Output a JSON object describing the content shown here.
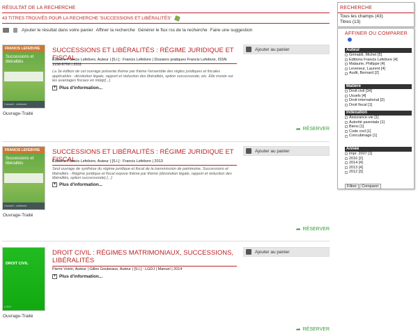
{
  "results": {
    "heading": "RÉSULTAT DE LA RECHERCHE",
    "count_text": "43 TITRES TROUVÉS POUR LA RECHERCHE 'SUCCESSIONS ET LIBÉRALITÉS'",
    "actions": [
      "Ajouter le résultat dans votre panier",
      "Affiner la recherche",
      "Générer le flux rss de la recherche",
      "Faire une suggestion"
    ],
    "more_label": "Plus d'information...",
    "cart_label": "Ajouter au panier",
    "reserve_label": "RÉSERVER",
    "items": [
      {
        "title": "SUCCESSIONS ET LIBÉRALITÉS : RÉGIME JURIDIQUE ET FISCAL",
        "meta": "Editions Francis Lefebvre, Auteur | [S.l.] : Francis Lefebvre | Dossiers pratiques Francis Lefebvre, ISSN 1158-8700 | 2011",
        "abstract": "La 3e édition de cet ouvrage présente thème par thème l'ensemble des règles juridiques et fiscales applicables : dévolution légale, rapport et réduction des libéralités, option successorale, etc. Elle insiste sur les avantages fiscaux en intégr[...]",
        "type": "Ouvrage-Traité",
        "cover_top": "FRANCIS LEFEBVRE",
        "cover_title": "Successions et libéralités",
        "cover_bottom": "Conseil - Lefebvre"
      },
      {
        "title": "SUCCESSIONS ET LIBÉRALITÉS : RÉGIME JURIDIQUE ET FISCAL",
        "meta": "Editions Francis Lefebvre, Auteur | [S.l.] : Francis Lefebvre | 2013",
        "abstract": "Seul ouvrage de synthèse du régime juridique et fiscal de la transmission de patrimoine, Successions et libéralités - Régime juridique et fiscal expose thème par thème (dévolution légale, rapport et réduction des libéralités, option successorale) [...]",
        "type": "Ouvrage-Traité",
        "cover_top": "FRANCIS LEFEBVRE",
        "cover_title": "Successions et libéralités",
        "cover_bottom": "Conseil - Lefebvre"
      },
      {
        "title": "DROIT CIVIL : RÉGIMES MATRIMONIAUX, SUCCESSIONS, LIBÉRALITÉS",
        "meta": "Pierre Voirin, Auteur | Gilles Goubeaux, Auteur | [S.l.] : LGDJ | Manuel | 2014",
        "abstract": "",
        "type": "Ouvrage-Traité",
        "cover_top": "",
        "cover_title": "DROIT CIVIL",
        "cover_bottom": "LGDJ"
      }
    ]
  },
  "sidebar": {
    "search_heading": "RECHERCHE",
    "search_lines": [
      "Tous les champs (43)",
      "Titres (13)"
    ],
    "refine_heading": "AFFINER OU COMPARER",
    "facets": [
      {
        "name": "Auteur",
        "items": [
          "Grimaldi, Michel [5]",
          "Editions Francis Lefebvre [4]",
          "Malaurie, Philippe [4]",
          "Leveneur, Laurent [4]",
          "Audit, Bernard [2]"
        ]
      },
      {
        "name": "Matière",
        "items": [
          "Droit civil [34]",
          "Usuels [4]",
          "Droit international [2]",
          "Droit fiscal [1]"
        ]
      },
      {
        "name": "Indexation",
        "items": [
          "Assurance-vie [1]",
          "Autorité parentale [1]",
          "Biens [1]",
          "Code civil [1]",
          "Concubinage [1]"
        ]
      },
      {
        "name": "Année",
        "items": [
          "impr. 2007 [1]",
          "2016 [2]",
          "2014 [4]",
          "2013 [4]",
          "2012 [3]"
        ]
      }
    ],
    "filter_label": "Filtrer",
    "compare_label": "Comparer"
  },
  "colors": {
    "accent": "#b22222",
    "reserve": "#339933",
    "cover_green": "#66aa44"
  }
}
